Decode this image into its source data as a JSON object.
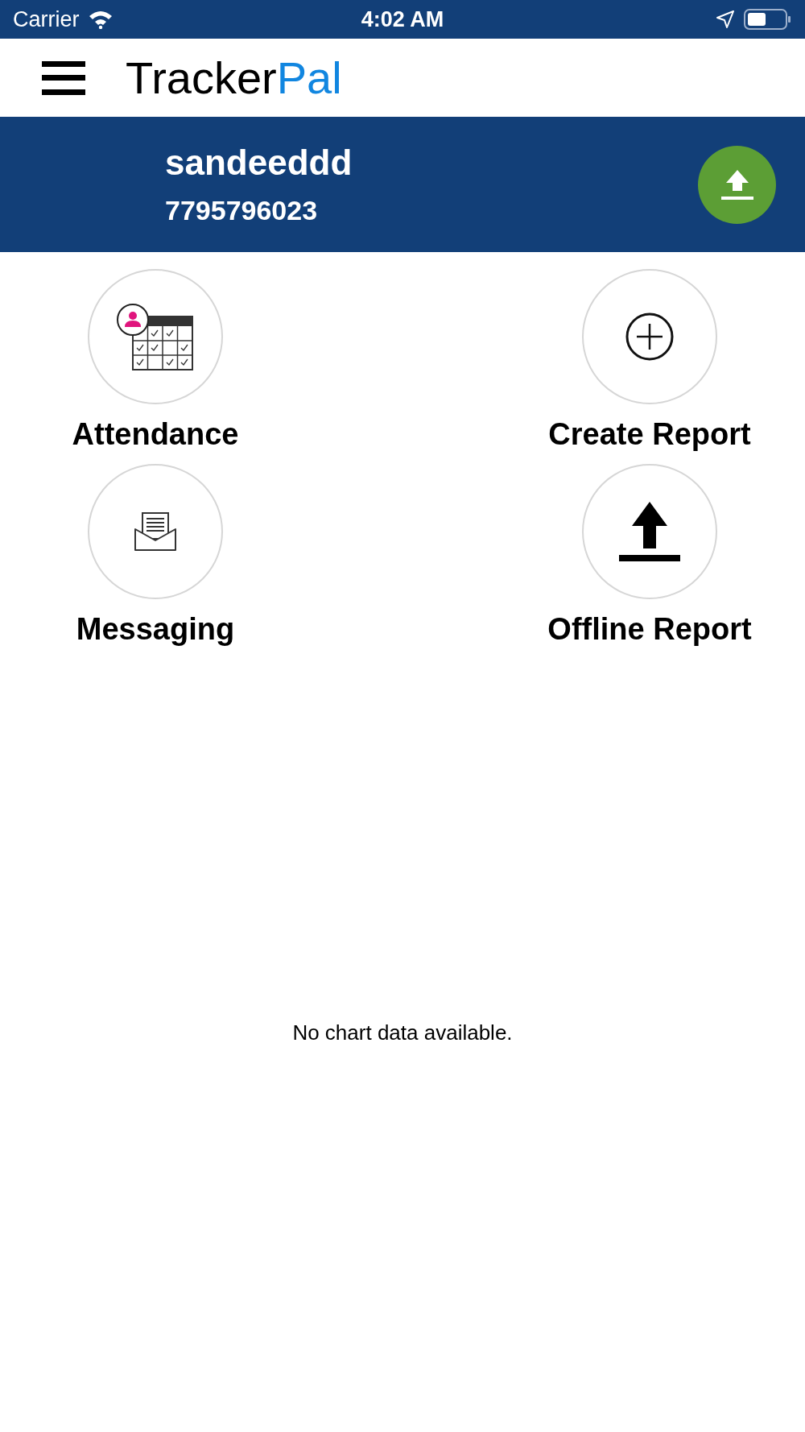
{
  "status_bar": {
    "carrier": "Carrier",
    "time": "4:02 AM"
  },
  "app_bar": {
    "logo": "Tracker",
    "logo_accent": "Pal"
  },
  "profile": {
    "name": "sandeeddd",
    "phone": "7795796023"
  },
  "tiles": [
    {
      "label": "Attendance",
      "kind": "calendar"
    },
    {
      "label": "Create Report",
      "kind": "plus"
    },
    {
      "label": "Messaging",
      "kind": "envelope"
    },
    {
      "label": "Offline Report",
      "kind": "upload"
    }
  ],
  "chart": {
    "message": "No chart data available."
  }
}
